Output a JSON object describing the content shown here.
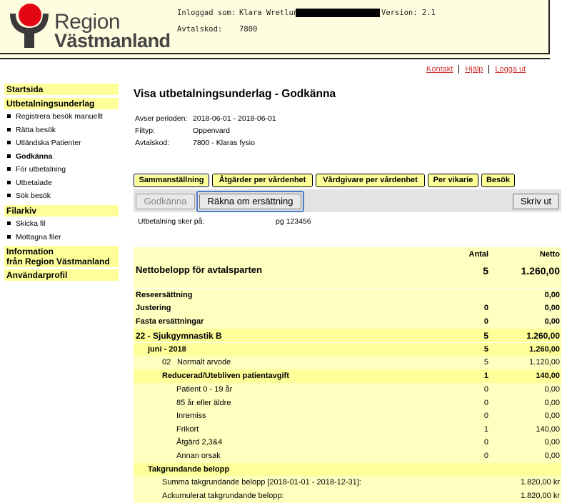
{
  "header": {
    "brand_line1": "Region",
    "brand_line2": "Västmanland",
    "logged_in_label": "Inloggad som:",
    "logged_in_value": "Klara Wretlund",
    "version": "Version: 2.1",
    "avtalskod_label": "Avtalskod:",
    "avtalskod_value": "7800",
    "colors": {
      "logo_red": "#e30613",
      "logo_dark": "#3a3a3a",
      "header_bg": "#fffde0"
    }
  },
  "toplinks": {
    "kontakt": "Kontakt",
    "hjalp": "Hjälp",
    "logga_ut": "Logga ut"
  },
  "sidebar": {
    "startsida": "Startsida",
    "utbetalningsunderlag": "Utbetalningsunderlag",
    "items1": [
      "Registrera besök manuellt",
      "Rätta besök",
      "Utländska Patienter",
      "Godkänna",
      "För utbetalning",
      "Utbetalade",
      "Sök besök"
    ],
    "filarkiv": "Filarkiv",
    "items2": [
      "Skicka fil",
      "Mottagna filer"
    ],
    "information_line1": "Information",
    "information_line2": "från Region Västmanland",
    "anvandarprofil": "Användarprofil"
  },
  "main": {
    "title": "Visa utbetalningsunderlag - Godkänna",
    "info": {
      "period_label": "Avser perioden:",
      "period_value": "2018-06-01 - 2018-06-01",
      "filtyp_label": "Filtyp:",
      "filtyp_value": "Oppenvard",
      "avtalskod_label": "Avtalskod:",
      "avtalskod_value": "7800 - Klaras fysio"
    },
    "tabs": [
      "Sammanställning",
      "Åtgärder per vårdenhet",
      "Vårdgivare per vårdenhet",
      "Per vikarie",
      "Besök"
    ],
    "buttons": {
      "godkanna": "Godkänna",
      "rakna_om": "Räkna om ersättning",
      "skriv_ut": "Skriv ut"
    },
    "payment_label": "Utbetalning sker på:",
    "payment_value": "pg 123456",
    "summary": {
      "antal_header": "Antal",
      "netto_header": "Netto",
      "label": "Nettobelopp för avtalsparten",
      "antal": "5",
      "netto": "1.260,00"
    },
    "rows": [
      {
        "label": "Reseersättning",
        "antal": "",
        "netto": "0,00"
      },
      {
        "label": "Justering",
        "antal": "0",
        "netto": "0,00"
      },
      {
        "label": "Fasta ersättningar",
        "antal": "0",
        "netto": "0,00"
      },
      {
        "label": "22 - Sjukgymnastik B",
        "antal": "5",
        "netto": "1.260,00"
      },
      {
        "label": "juni - 2018",
        "antal": "5",
        "netto": "1.260,00"
      },
      {
        "label_code": "02",
        "label": "Normalt arvode",
        "antal": "5",
        "netto": "1.120,00"
      },
      {
        "label": "Reducerad/Utebliven patientavgift",
        "antal": "1",
        "netto": "140,00"
      },
      {
        "label": "Patient 0 - 19 år",
        "antal": "0",
        "netto": "0,00"
      },
      {
        "label": "85 år eller äldre",
        "antal": "0",
        "netto": "0,00"
      },
      {
        "label": "Inremiss",
        "antal": "0",
        "netto": "0,00"
      },
      {
        "label": "Frikort",
        "antal": "1",
        "netto": "140,00"
      },
      {
        "label": "Åtgärd 2,3&4",
        "antal": "0",
        "netto": "0,00"
      },
      {
        "label": "Annan orsak",
        "antal": "0",
        "netto": "0,00"
      },
      {
        "label": "Takgrundande belopp",
        "antal": "",
        "netto": ""
      },
      {
        "label": "Summa takgrundande belopp [2018-01-01 - 2018-12-31]:",
        "antal": "",
        "netto": "1.820,00 kr"
      },
      {
        "label": "Ackumulerat takgrundande belopp:",
        "antal": "",
        "netto": "1.820,00 kr"
      }
    ]
  }
}
